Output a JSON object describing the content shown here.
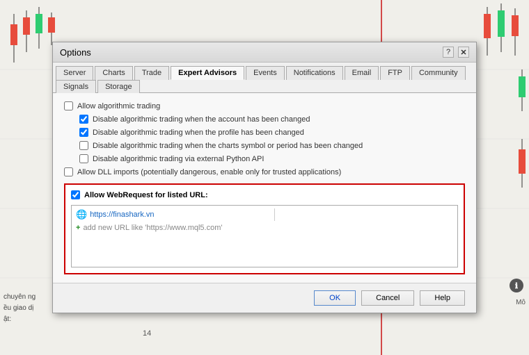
{
  "dialog": {
    "title": "Options",
    "help_btn": "?",
    "close_btn": "✕",
    "tabs": [
      {
        "label": "Server",
        "active": false
      },
      {
        "label": "Charts",
        "active": false
      },
      {
        "label": "Trade",
        "active": false
      },
      {
        "label": "Expert Advisors",
        "active": true
      },
      {
        "label": "Events",
        "active": false
      },
      {
        "label": "Notifications",
        "active": false
      },
      {
        "label": "Email",
        "active": false
      },
      {
        "label": "FTP",
        "active": false
      },
      {
        "label": "Community",
        "active": false
      },
      {
        "label": "Signals",
        "active": false
      },
      {
        "label": "Storage",
        "active": false
      }
    ],
    "options": {
      "allow_algo_trading": {
        "label": "Allow algorithmic trading",
        "checked": false
      },
      "sub_options": [
        {
          "label": "Disable algorithmic trading when the account has been changed",
          "checked": true,
          "disabled": false
        },
        {
          "label": "Disable algorithmic trading when the profile has been changed",
          "checked": true,
          "disabled": false
        },
        {
          "label": "Disable algorithmic trading when the charts symbol or period has been changed",
          "checked": false,
          "disabled": false
        },
        {
          "label": "Disable algorithmic trading via external Python API",
          "checked": false,
          "disabled": false
        }
      ],
      "allow_dll_imports": {
        "label": "Allow DLL imports (potentially dangerous, enable only for trusted applications)",
        "checked": false
      },
      "allow_webrequest": {
        "label": "Allow WebRequest for listed URL:",
        "checked": true
      }
    },
    "url_list": {
      "url": "https://finashark.vn",
      "add_placeholder": "add new URL like 'https://www.mql5.com'"
    },
    "footer": {
      "ok": "OK",
      "cancel": "Cancel",
      "help": "Help"
    }
  },
  "chart_bg": {
    "side_texts": [
      "chuyên ng",
      "ều giao dị",
      "ật:"
    ],
    "bottom_number": "14",
    "right_label": "Mô"
  },
  "icons": {
    "globe": "🌐",
    "plus": "+",
    "info": "ℹ"
  }
}
